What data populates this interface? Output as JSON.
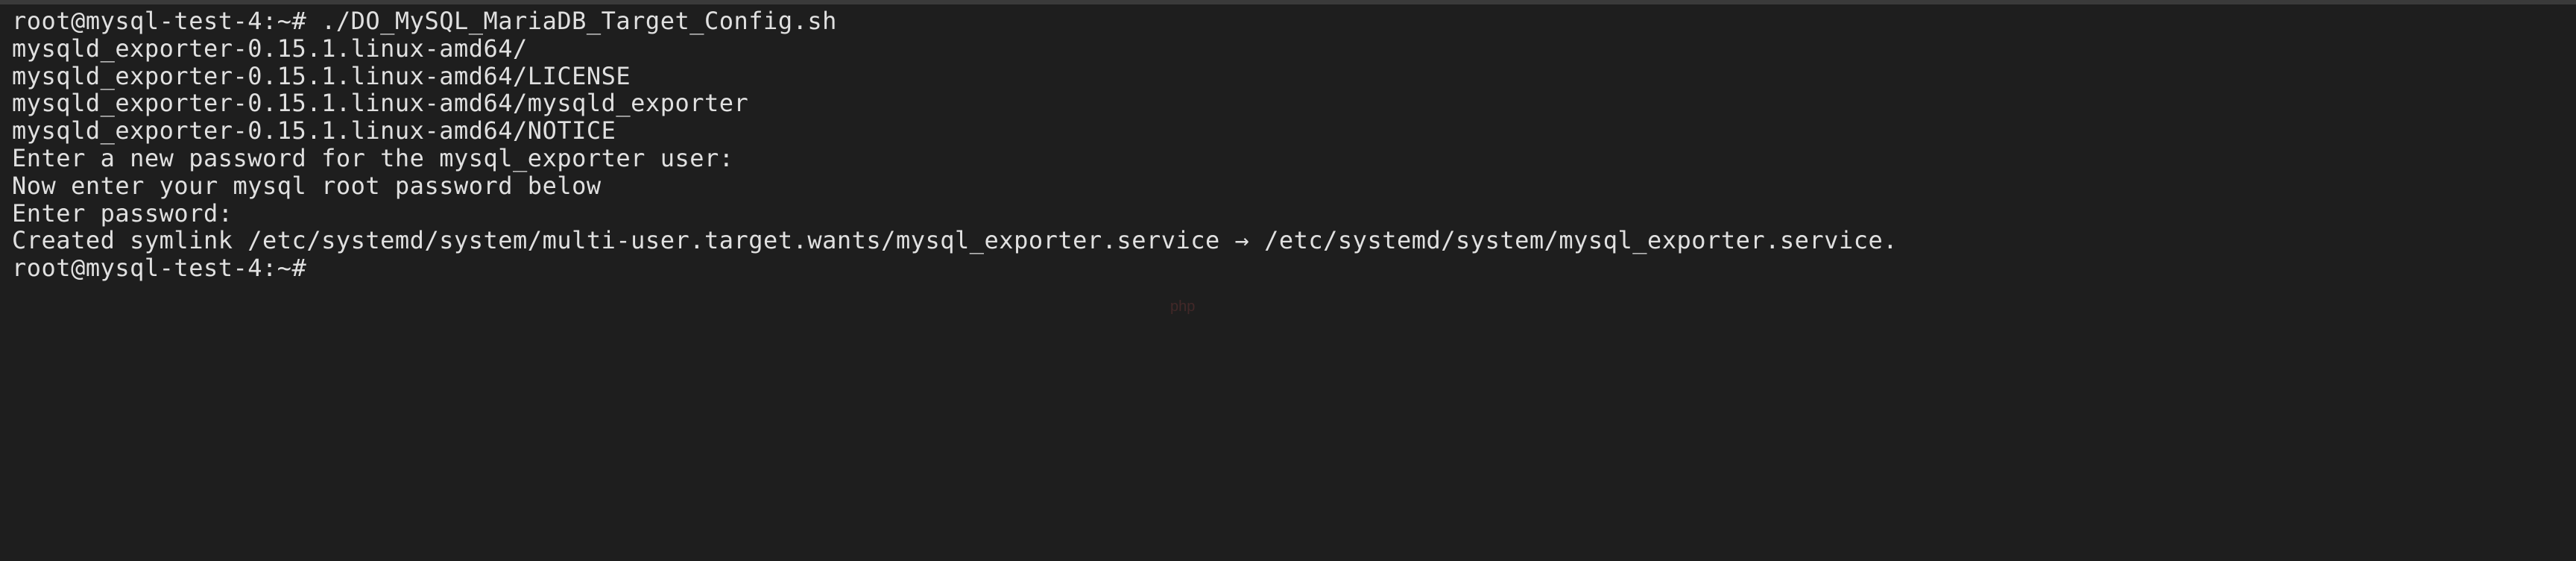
{
  "terminal": {
    "lines": [
      "root@mysql-test-4:~# ./DO_MySQL_MariaDB_Target_Config.sh",
      "mysqld_exporter-0.15.1.linux-amd64/",
      "mysqld_exporter-0.15.1.linux-amd64/LICENSE",
      "mysqld_exporter-0.15.1.linux-amd64/mysqld_exporter",
      "mysqld_exporter-0.15.1.linux-amd64/NOTICE",
      "Enter a new password for the mysql_exporter user:",
      "Now enter your mysql root password below",
      "Enter password:",
      "Created symlink /etc/systemd/system/multi-user.target.wants/mysql_exporter.service → /etc/systemd/system/mysql_exporter.service.",
      "root@mysql-test-4:~#"
    ]
  },
  "watermark": "php"
}
